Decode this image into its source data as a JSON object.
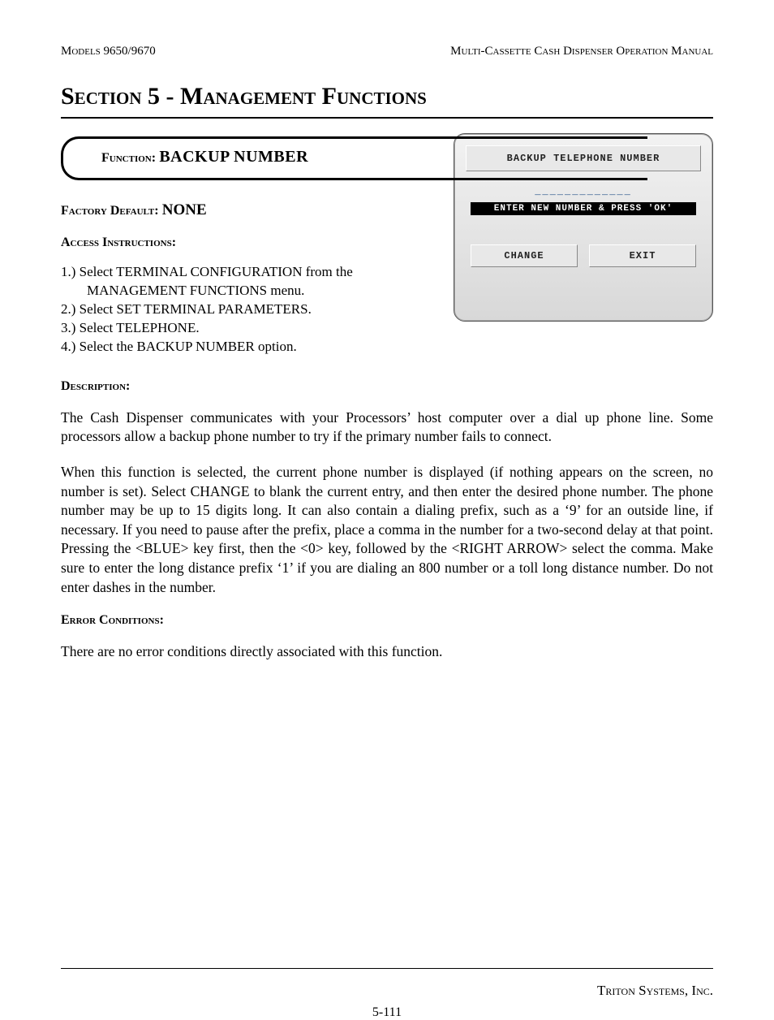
{
  "header": {
    "left": "Models 9650/9670",
    "right": "Multi-Cassette Cash Dispenser Operation Manual"
  },
  "section_title": "Section 5 - Management Functions",
  "function_box": {
    "label": "Function:",
    "value": "BACKUP NUMBER"
  },
  "terminal": {
    "title": "BACKUP TELEPHONE NUMBER",
    "dashes": "_____________",
    "instruction": "ENTER NEW NUMBER & PRESS 'OK'",
    "button_change": "CHANGE",
    "button_exit": "EXIT"
  },
  "factory_default": {
    "label": "Factory Default:",
    "value": "NONE"
  },
  "access": {
    "heading": "Access Instructions:",
    "steps": [
      "1.)  Select TERMINAL CONFIGURATION from the MANAGEMENT FUNCTIONS menu.",
      "2.)  Select SET TERMINAL PARAMETERS.",
      "3.)  Select TELEPHONE.",
      "4.)  Select the BACKUP NUMBER option."
    ]
  },
  "description": {
    "heading": "Description:",
    "p1": "The Cash Dispenser communicates with your  Processors’ host computer over a dial up phone line. Some processors allow a backup phone number to try if the primary number fails to connect.",
    "p2": "When this function is selected, the current phone number is displayed (if nothing appears on the screen, no number is set).  Select CHANGE to blank the current entry, and then enter the desired phone number.  The phone number may be up to 15 digits long.  It can also contain a dialing prefix, such as a ‘9’ for an outside line, if necessary.  If you need to pause after the prefix, place a comma in the number for a two-second delay at that point.  Pressing the <BLUE> key first, then the <0> key, followed by the <RIGHT ARROW> select the comma.  Make sure to enter the long distance prefix ‘1’ if you are dialing an 800 number or a toll long distance number.  Do not enter dashes in the number."
  },
  "error": {
    "heading": "Error Conditions:",
    "text": "There are no error conditions directly associated with this function."
  },
  "footer": {
    "company": "Triton Systems, Inc.",
    "page": "5-111"
  }
}
